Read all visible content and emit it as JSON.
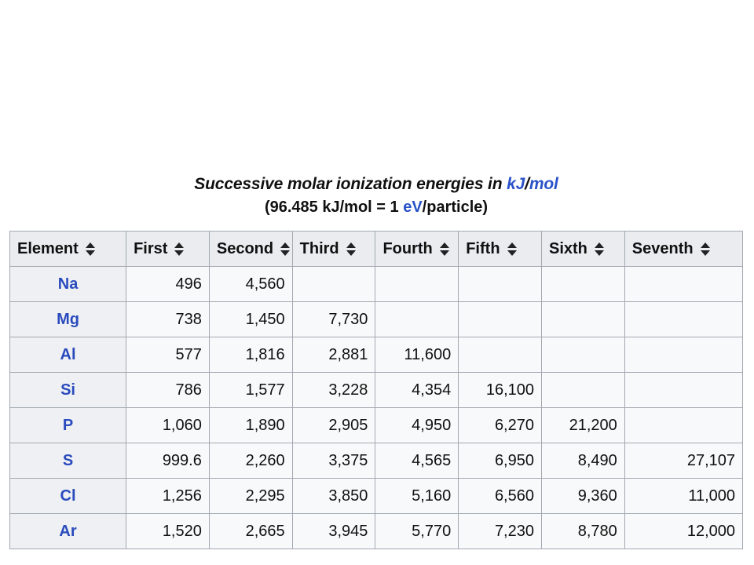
{
  "caption": {
    "line1_prefix": "Successive molar ionization energies in ",
    "line1_unit_a": "kJ",
    "line1_sep": "/",
    "line1_unit_b": "mol",
    "line2_prefix": "(96.485 kJ/mol = 1 ",
    "line2_unit": "eV",
    "line2_suffix": "/particle)"
  },
  "table": {
    "sort_icon": "sort-updown-icon",
    "columns": [
      {
        "key": "element",
        "label": "Element",
        "sortable": true,
        "align": "center"
      },
      {
        "key": "first",
        "label": "First",
        "sortable": true,
        "align": "right"
      },
      {
        "key": "second",
        "label": "Second",
        "sortable": true,
        "align": "right"
      },
      {
        "key": "third",
        "label": "Third",
        "sortable": true,
        "align": "right"
      },
      {
        "key": "fourth",
        "label": "Fourth",
        "sortable": true,
        "align": "right"
      },
      {
        "key": "fifth",
        "label": "Fifth",
        "sortable": true,
        "align": "right"
      },
      {
        "key": "sixth",
        "label": "Sixth",
        "sortable": true,
        "align": "right"
      },
      {
        "key": "seventh",
        "label": "Seventh",
        "sortable": true,
        "align": "right"
      }
    ],
    "rows": [
      {
        "element": "Na",
        "first": "496",
        "second": "4,560",
        "third": "",
        "fourth": "",
        "fifth": "",
        "sixth": "",
        "seventh": ""
      },
      {
        "element": "Mg",
        "first": "738",
        "second": "1,450",
        "third": "7,730",
        "fourth": "",
        "fifth": "",
        "sixth": "",
        "seventh": ""
      },
      {
        "element": "Al",
        "first": "577",
        "second": "1,816",
        "third": "2,881",
        "fourth": "11,600",
        "fifth": "",
        "sixth": "",
        "seventh": ""
      },
      {
        "element": "Si",
        "first": "786",
        "second": "1,577",
        "third": "3,228",
        "fourth": "4,354",
        "fifth": "16,100",
        "sixth": "",
        "seventh": ""
      },
      {
        "element": "P",
        "first": "1,060",
        "second": "1,890",
        "third": "2,905",
        "fourth": "4,950",
        "fifth": "6,270",
        "sixth": "21,200",
        "seventh": ""
      },
      {
        "element": "S",
        "first": "999.6",
        "second": "2,260",
        "third": "3,375",
        "fourth": "4,565",
        "fifth": "6,950",
        "sixth": "8,490",
        "seventh": "27,107"
      },
      {
        "element": "Cl",
        "first": "1,256",
        "second": "2,295",
        "third": "3,850",
        "fourth": "5,160",
        "fifth": "6,560",
        "sixth": "9,360",
        "seventh": "11,000"
      },
      {
        "element": "Ar",
        "first": "1,520",
        "second": "2,665",
        "third": "3,945",
        "fourth": "5,770",
        "fifth": "7,230",
        "sixth": "8,780",
        "seventh": "12,000"
      }
    ]
  },
  "colors": {
    "link": "#2952c8",
    "element_text": "#2a4bbd",
    "header_bg": "#eaecf0",
    "cell_bg": "#f8f9fa",
    "border": "#a2a9b1",
    "text": "#101010",
    "page_bg": "#ffffff"
  }
}
